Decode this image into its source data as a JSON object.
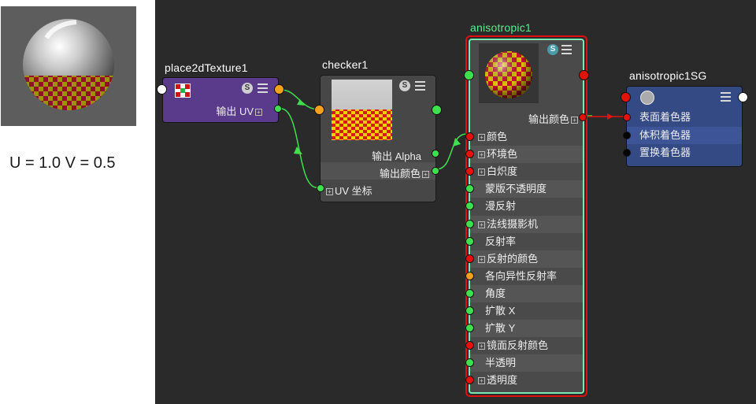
{
  "left_panel": {
    "uv_readout": "U = 1.0 V = 0.5"
  },
  "colors": {
    "graph_bg": "#2a2a2a",
    "place2d_node": "#5a3a8a",
    "checker_node": "#474747",
    "aniso_node": "#4a4a4a",
    "sg_node": "#344a85",
    "selection_red": "#e01010",
    "selection_green": "#7ce9b5",
    "port_green": "#3fe04e",
    "port_orange": "#f5a11c",
    "port_red": "#e3120b",
    "wire_green": "#3fe04e",
    "wire_red": "#e3120b"
  },
  "nodes": {
    "place2d": {
      "title": "place2dTexture1",
      "s_label": "S",
      "out_label": "输出 UV",
      "icon": "place2d-texture-icon"
    },
    "checker": {
      "title": "checker1",
      "s_label": "S",
      "out_alpha": "输出 Alpha",
      "out_color": "输出颜色",
      "uv_coord": "UV 坐标"
    },
    "aniso": {
      "title": "anisotropic1",
      "s_label": "S",
      "out_color": "输出颜色",
      "attributes": [
        {
          "label": "颜色",
          "port": "red",
          "expand": true
        },
        {
          "label": "环境色",
          "port": "red",
          "expand": true
        },
        {
          "label": "白炽度",
          "port": "red",
          "expand": true
        },
        {
          "label": "蒙版不透明度",
          "port": "green",
          "expand": false
        },
        {
          "label": "漫反射",
          "port": "green",
          "expand": false
        },
        {
          "label": "法线摄影机",
          "port": "green",
          "expand": true
        },
        {
          "label": "反射率",
          "port": "green",
          "expand": false
        },
        {
          "label": "反射的颜色",
          "port": "red",
          "expand": true
        },
        {
          "label": "各向异性反射率",
          "port": "orange",
          "expand": false
        },
        {
          "label": "角度",
          "port": "green",
          "expand": false
        },
        {
          "label": "扩散 X",
          "port": "green",
          "expand": false
        },
        {
          "label": "扩散 Y",
          "port": "green",
          "expand": false
        },
        {
          "label": "镜面反射颜色",
          "port": "red",
          "expand": true
        },
        {
          "label": "半透明",
          "port": "green",
          "expand": false
        },
        {
          "label": "透明度",
          "port": "red",
          "expand": true
        }
      ]
    },
    "sg": {
      "title": "anisotropic1SG",
      "rows": [
        {
          "label": "表面着色器",
          "port": "red"
        },
        {
          "label": "体积着色器",
          "port": "black"
        },
        {
          "label": "置换着色器",
          "port": "black"
        }
      ]
    }
  }
}
